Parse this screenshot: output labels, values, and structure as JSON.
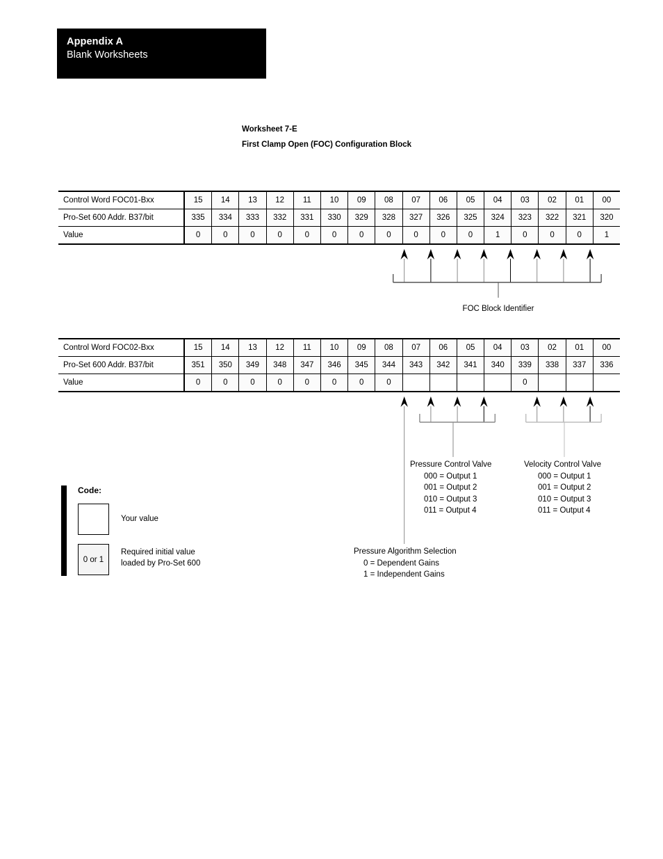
{
  "banner": {
    "title": "Appendix A",
    "subtitle": "Blank Worksheets"
  },
  "worksheet": {
    "number": "Worksheet 7-E",
    "name": "First Clamp Open (FOC) Configuration Block"
  },
  "tables": [
    {
      "row_labels": {
        "control_word": "Control Word FOC01-Bxx",
        "address": "Pro-Set 600 Addr. B37/bit",
        "value": "Value"
      },
      "bits": [
        "15",
        "14",
        "13",
        "12",
        "11",
        "10",
        "09",
        "08",
        "07",
        "06",
        "05",
        "04",
        "03",
        "02",
        "01",
        "00"
      ],
      "addresses": [
        "335",
        "334",
        "333",
        "332",
        "331",
        "330",
        "329",
        "328",
        "327",
        "326",
        "325",
        "324",
        "323",
        "322",
        "321",
        "320"
      ],
      "values": [
        "0",
        "0",
        "0",
        "0",
        "0",
        "0",
        "0",
        "0",
        "0",
        "0",
        "0",
        "1",
        "0",
        "0",
        "0",
        "1"
      ]
    },
    {
      "row_labels": {
        "control_word": "Control Word FOC02-Bxx",
        "address": "Pro-Set 600 Addr. B37/bit",
        "value": "Value"
      },
      "bits": [
        "15",
        "14",
        "13",
        "12",
        "11",
        "10",
        "09",
        "08",
        "07",
        "06",
        "05",
        "04",
        "03",
        "02",
        "01",
        "00"
      ],
      "addresses": [
        "351",
        "350",
        "349",
        "348",
        "347",
        "346",
        "345",
        "344",
        "343",
        "342",
        "341",
        "340",
        "339",
        "338",
        "337",
        "336"
      ],
      "values": [
        "0",
        "0",
        "0",
        "0",
        "0",
        "0",
        "0",
        "0",
        "",
        "",
        "",
        "",
        "0",
        "",
        "",
        ""
      ]
    }
  ],
  "callouts": {
    "foc_block_identifier": "FOC Block Identifier",
    "pressure_control_valve": {
      "title": "Pressure Control Valve",
      "options": [
        "000 = Output 1",
        "001 = Output 2",
        "010 = Output 3",
        "011 = Output 4"
      ]
    },
    "velocity_control_valve": {
      "title": "Velocity Control Valve",
      "options": [
        "000 = Output 1",
        "001 = Output 2",
        "010 = Output 3",
        "011 = Output 4"
      ]
    },
    "pressure_algorithm_selection": {
      "title": "Pressure Algorithm Selection",
      "options": [
        "0 = Dependent Gains",
        "1 = Independent Gains"
      ]
    }
  },
  "legend": {
    "title": "Code:",
    "box1_value": "",
    "box1_text": "Your value",
    "box2_value": "0 or 1",
    "box2_text_line1": "Required initial value",
    "box2_text_line2": "loaded by Pro-Set 600"
  }
}
